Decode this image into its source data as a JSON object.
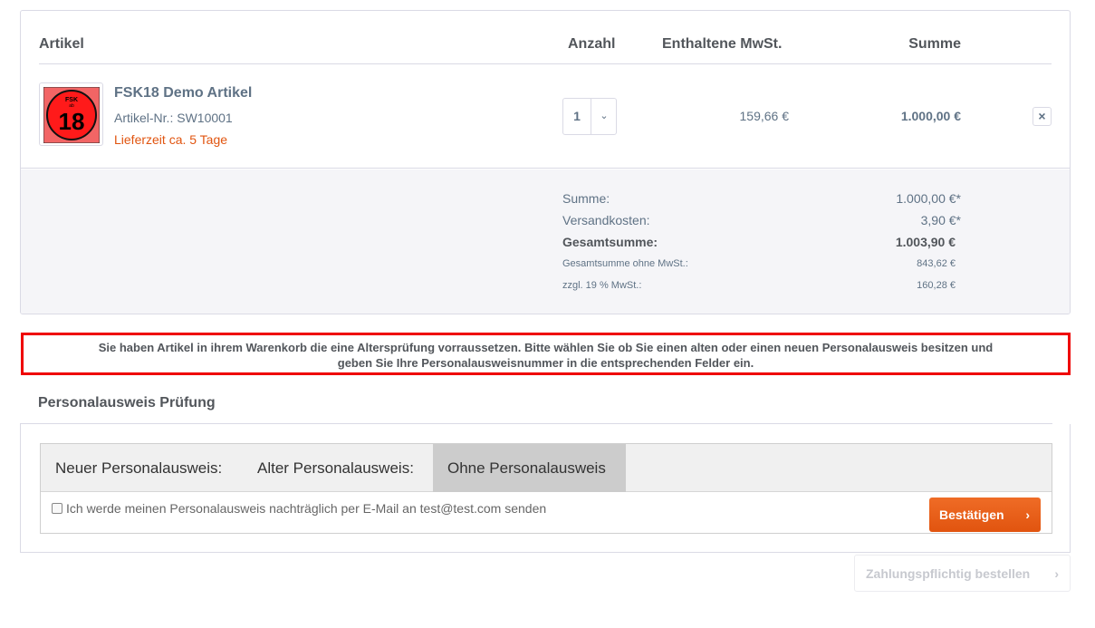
{
  "table_header": {
    "article": "Artikel",
    "quantity": "Anzahl",
    "tax": "Enthaltene MwSt.",
    "sum": "Summe"
  },
  "item": {
    "name": "FSK18 Demo Artikel",
    "number": "Artikel-Nr.: SW10001",
    "delivery": "Lieferzeit ca. 5 Tage",
    "quantity": "1",
    "tax": "159,66 €",
    "sum": "1.000,00 €",
    "badge": {
      "top": "FSK",
      "mid": "ab",
      "age": "18"
    }
  },
  "totals": {
    "subtotal_label": "Summe:",
    "subtotal_value": "1.000,00 €*",
    "shipping_label": "Versandkosten:",
    "shipping_value": "3,90 €*",
    "total_label": "Gesamtsumme:",
    "total_value": "1.003,90 €",
    "net_label": "Gesamtsumme ohne MwSt.:",
    "net_value": "843,62 €",
    "vat_label": "zzgl. 19 % MwSt.:",
    "vat_value": "160,28 €"
  },
  "notice": {
    "line1": "Sie haben Artikel in ihrem Warenkorb die eine Altersprüfung vorraussetzen. Bitte wählen Sie ob Sie einen alten oder einen neuen Personalausweis besitzen und",
    "line2": "geben Sie Ihre Personalausweisnummer in die entsprechenden Felder ein."
  },
  "id_check": {
    "title": "Personalausweis Prüfung",
    "tabs": [
      "Neuer Personalausweis:",
      "Alter Personalausweis:",
      "Ohne Personalausweis"
    ],
    "active_tab": 2,
    "checkbox_label": "Ich werde meinen Personalausweis nachträglich per E-Mail an test@test.com senden",
    "checkbox_checked": false,
    "confirm_label": "Bestätigen"
  },
  "order_button_label": "Zahlungspflichtig bestellen",
  "colors": {
    "accent": "#e1540f",
    "notice_border": "#ef0000",
    "text": "#5f7285"
  }
}
